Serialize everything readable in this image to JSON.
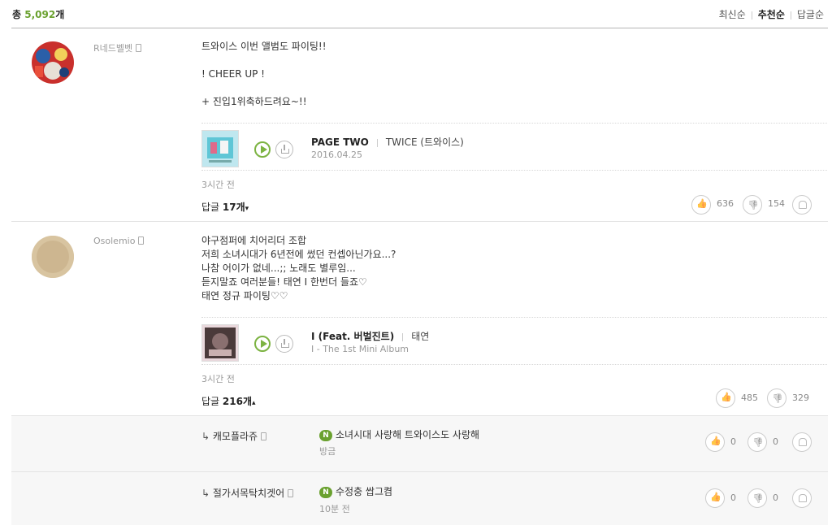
{
  "header": {
    "total_prefix": "총",
    "total_count": "5,092",
    "total_suffix": "개",
    "sort_options": [
      "최신순",
      "추천순",
      "답글순"
    ],
    "active_sort": "추천순"
  },
  "comments": [
    {
      "nickname": "R네드벨벳",
      "lines": [
        "트와이스 이번 앨범도 파이팅!!",
        "",
        "! CHEER UP !",
        "",
        "+ 진입1위축하드려요~!!"
      ],
      "song": {
        "title": "PAGE TWO",
        "artist": "TWICE (트와이스)",
        "meta": "2016.04.25"
      },
      "time": "3시간 전",
      "reply_label": "답글",
      "reply_count": "17개",
      "reply_arrow": "▾",
      "likes": "636",
      "dislikes": "154"
    },
    {
      "nickname": "Osolemio",
      "lines": [
        "야구점퍼에 치어리더 조합",
        "저희 소녀시대가 6년전에 썼던 컨셉아닌가요...?",
        "나참 어이가 없네...;; 노래도 별루임...",
        "듣지말죠 여러분들! 태연 I 한번더 들죠♡",
        "태연 정규 파이팅♡♡"
      ],
      "song": {
        "title": "I (Feat. 버벌진트)",
        "artist": "태연",
        "meta": "I - The 1st Mini Album"
      },
      "time": "3시간 전",
      "reply_label": "답글",
      "reply_count": "216개",
      "reply_arrow": "▴",
      "likes": "485",
      "dislikes": "329"
    }
  ],
  "replies": [
    {
      "arrow": "↳",
      "nickname": "캐모플라쥬",
      "badge": "N",
      "text": "소녀시대 사랑해 트와이스도 사랑해",
      "time": "방금",
      "likes": "0",
      "dislikes": "0"
    },
    {
      "arrow": "↳",
      "nickname": "절가서목탁치겟어",
      "badge": "N",
      "text": "수정충 쌉그켬",
      "time": "10분 전",
      "likes": "0",
      "dislikes": "0"
    }
  ]
}
